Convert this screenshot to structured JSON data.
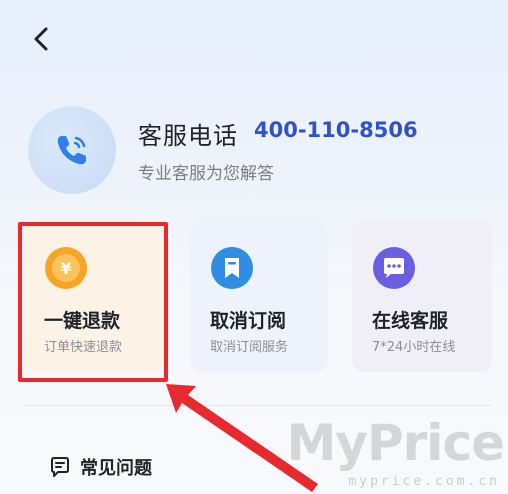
{
  "header": {
    "back_icon": "chevron-left-icon"
  },
  "hotline": {
    "title": "客服电话",
    "number": "400-110-8506",
    "subtitle": "专业客服为您解答",
    "icon": "phone-icon",
    "accent": "#3052c9"
  },
  "actions": [
    {
      "title": "一键退款",
      "subtitle": "订单快速退款",
      "icon": "yuan-coin-icon",
      "color": "#f5a523"
    },
    {
      "title": "取消订阅",
      "subtitle": "取消订阅服务",
      "icon": "bookmark-icon",
      "color": "#2f8de4"
    },
    {
      "title": "在线客服",
      "subtitle": "7*24小时在线",
      "icon": "chat-bubble-icon",
      "color": "#6a5fe0"
    }
  ],
  "faq": {
    "label": "常见问题",
    "icon": "chat-question-icon"
  },
  "annotation": {
    "highlight_color": "#e8292e"
  },
  "watermark": {
    "text": "MyPrice",
    "sub": "myprice.com.cn"
  }
}
